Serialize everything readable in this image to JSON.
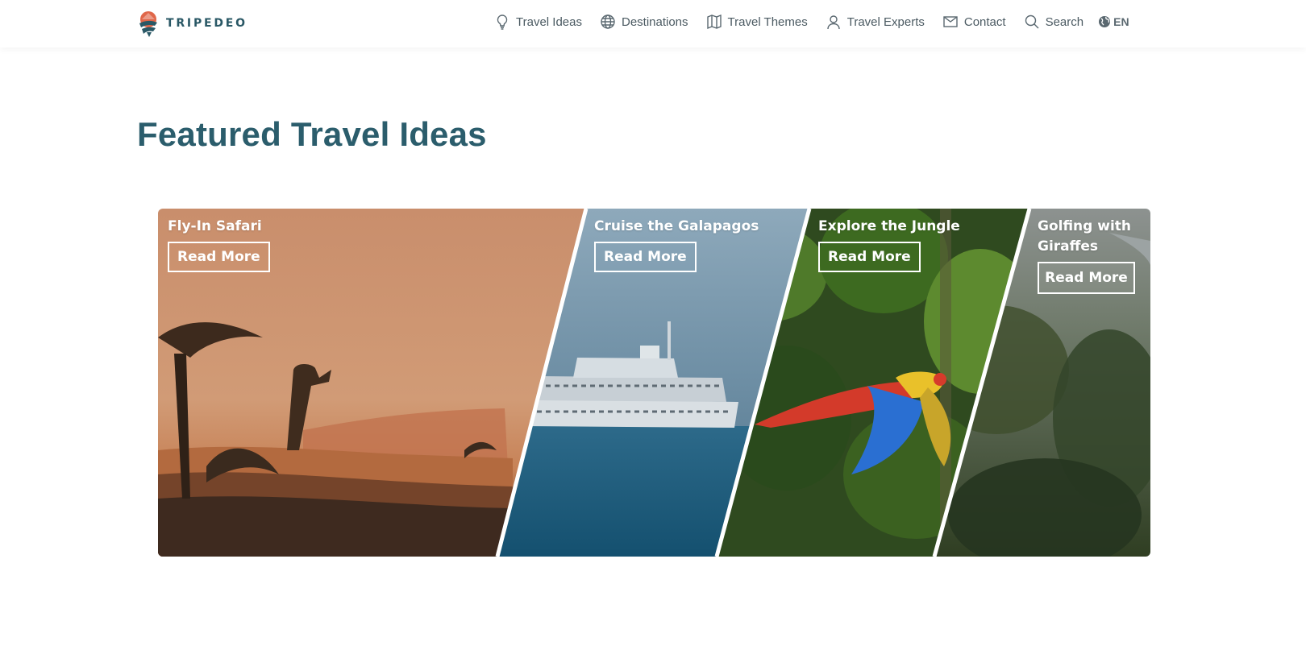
{
  "brand": {
    "name": "TRIPEDEO"
  },
  "nav": {
    "items": [
      {
        "label": "Travel Ideas",
        "icon": "lightbulb-icon"
      },
      {
        "label": "Destinations",
        "icon": "globe-icon"
      },
      {
        "label": "Travel Themes",
        "icon": "map-icon"
      },
      {
        "label": "Travel Experts",
        "icon": "user-icon"
      },
      {
        "label": "Contact",
        "icon": "mail-icon"
      },
      {
        "label": "Search",
        "icon": "search-icon"
      }
    ],
    "language": "EN"
  },
  "page": {
    "title": "Featured Travel Ideas"
  },
  "cards": [
    {
      "title": "Fly-In Safari",
      "button": "Read More"
    },
    {
      "title": "Cruise the Galapagos",
      "button": "Read More"
    },
    {
      "title": "Explore the Jungle",
      "button": "Read More"
    },
    {
      "title": "Golfing with Giraffes",
      "button": "Read More"
    }
  ],
  "colors": {
    "title": "#2b5d6c",
    "brand": "#2a5866",
    "accent": "#e0674a"
  }
}
